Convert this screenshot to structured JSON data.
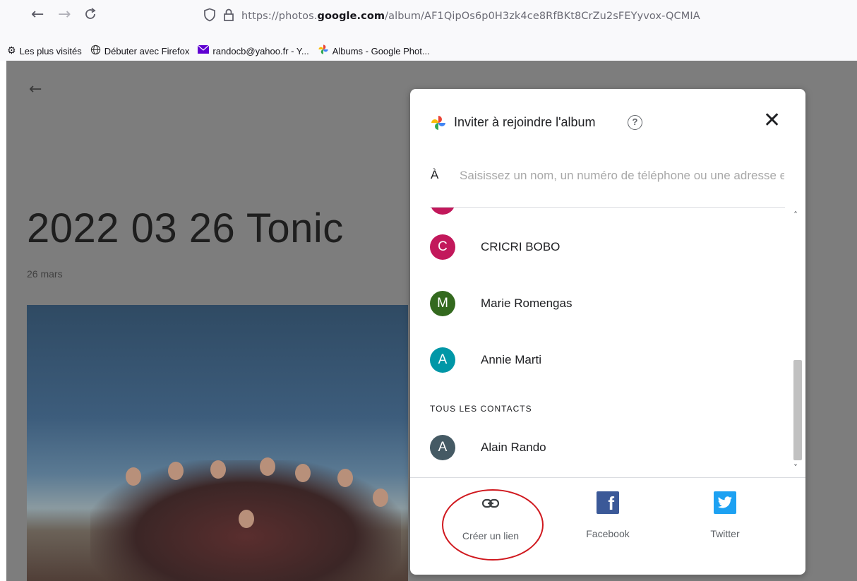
{
  "browser": {
    "back_icon": "←",
    "forward_icon": "→",
    "reload_icon": "C",
    "url_prefix": "https://photos.",
    "url_domain": "google.com",
    "url_suffix": "/album/AF1QipOs6p0H3zk4ce8RfBKt8CrZu2sFEYyvox-QCMIA",
    "bookmarks": [
      {
        "icon": "gear-icon",
        "label": "Les plus visités"
      },
      {
        "icon": "globe-icon",
        "label": "Débuter avec Firefox"
      },
      {
        "icon": "mail-icon",
        "label": "randocb@yahoo.fr - Y..."
      },
      {
        "icon": "pinwheel-icon",
        "label": "Albums - Google Phot..."
      }
    ]
  },
  "album": {
    "title": "2022 03 26 Tonic",
    "date": "26 mars"
  },
  "modal": {
    "title": "Inviter à rejoindre l'album",
    "help_glyph": "?",
    "close_glyph": "✕",
    "to_label": "À",
    "to_placeholder": "Saisissez un nom, un numéro de téléphone ou une adresse e-mail",
    "contacts": [
      {
        "initial": "C",
        "name": "CRICRI BOBO",
        "color": "#c2185b"
      },
      {
        "initial": "M",
        "name": "Marie Romengas",
        "color": "#33691e"
      },
      {
        "initial": "A",
        "name": "Annie Marti",
        "color": "#0097a7"
      }
    ],
    "section_label": "TOUS LES CONTACTS",
    "all_contacts": [
      {
        "initial": "A",
        "name": "Alain Rando",
        "color": "#455a64"
      }
    ],
    "share_options": {
      "link_label": "Créer un lien",
      "facebook_label": "Facebook",
      "facebook_glyph": "f",
      "twitter_label": "Twitter"
    }
  }
}
